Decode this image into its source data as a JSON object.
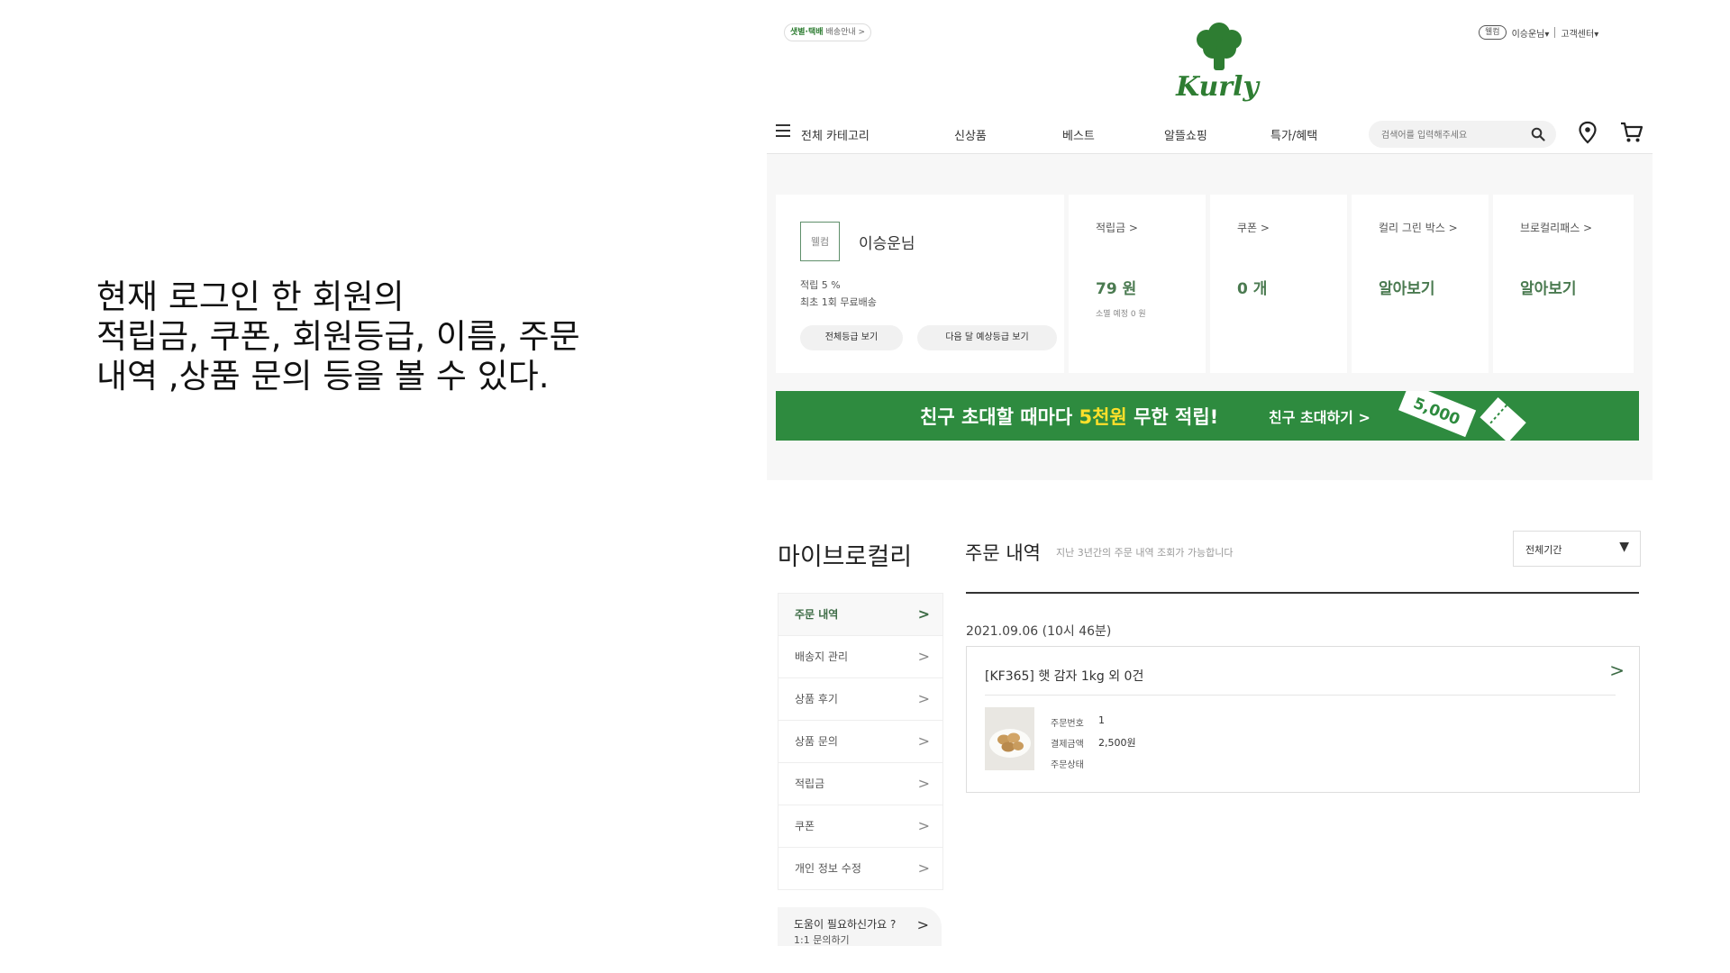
{
  "caption": {
    "line1": "현재 로그인 한 회원의",
    "line2": "적립금, 쿠폰, 회원등급, 이름, 주문",
    "line3": "내역 ,상품 문의 등을 볼 수 있다."
  },
  "header": {
    "ship_badge_highlight": "샛별·택배",
    "ship_badge_text": "배송안내 >",
    "logo_text": "Kurly",
    "grade_badge": "웰컴",
    "user_menu": "이승운님▾",
    "customer_center": "고객센터▾"
  },
  "nav": {
    "all_categories": "전체 카테고리",
    "items": [
      "신상품",
      "베스트",
      "알뜰쇼핑",
      "특가/혜택"
    ],
    "search_placeholder": "검색어를 입력해주세요"
  },
  "member": {
    "grade": "웰컴",
    "name": "이승운님",
    "benefit1": "적립 5 %",
    "benefit2": "최초 1회 무료배송",
    "btn_all_grades": "전체등급 보기",
    "btn_next_grade": "다음 달 예상등급 보기"
  },
  "stats": {
    "points": {
      "title": "적립금 >",
      "value": "79 원",
      "sub": "소멸 예정 0 원"
    },
    "coupon": {
      "title": "쿠폰 >",
      "value": "0 개"
    },
    "green_box": {
      "title": "컬리 그린 박스 >",
      "value": "알아보기"
    },
    "pass": {
      "title": "브로컬리패스 >",
      "value": "알아보기"
    }
  },
  "banner": {
    "pre": "친구 초대할 때마다 ",
    "highlight": "5천원",
    "post": " 무한 적립!",
    "cta": "친구 초대하기 >",
    "ticket": "5,000"
  },
  "mypage": {
    "title": "마이브로컬리",
    "menu": [
      {
        "label": "주문 내역",
        "chev": ">"
      },
      {
        "label": "배송지 관리",
        "chev": ">"
      },
      {
        "label": "상품 후기",
        "chev": ">"
      },
      {
        "label": "상품 문의",
        "chev": ">"
      },
      {
        "label": "적립금",
        "chev": ">"
      },
      {
        "label": "쿠폰",
        "chev": ">"
      },
      {
        "label": "개인 정보 수정",
        "chev": ">"
      }
    ],
    "help_title": "도움이 필요하신가요 ?",
    "help_sub": "1:1 문의하기",
    "help_chev": ">"
  },
  "orders": {
    "title": "주문 내역",
    "desc": "지난 3년간의 주문 내역 조회가 가능합니다",
    "period": "전체기간",
    "period_arrow": "▼",
    "date": "2021.09.06 (10시 46분)",
    "item": "[KF365] 햇 감자 1kg 외 0건",
    "chev": ">",
    "labels": {
      "order_no": "주문번호",
      "amount": "결제금액",
      "status": "주문상태"
    },
    "values": {
      "order_no": "1",
      "amount": "2,500원",
      "status": ""
    }
  },
  "colors": {
    "brand_green": "#2e8b3f",
    "text_green": "#4a7a50",
    "highlight": "#ffe02a"
  }
}
